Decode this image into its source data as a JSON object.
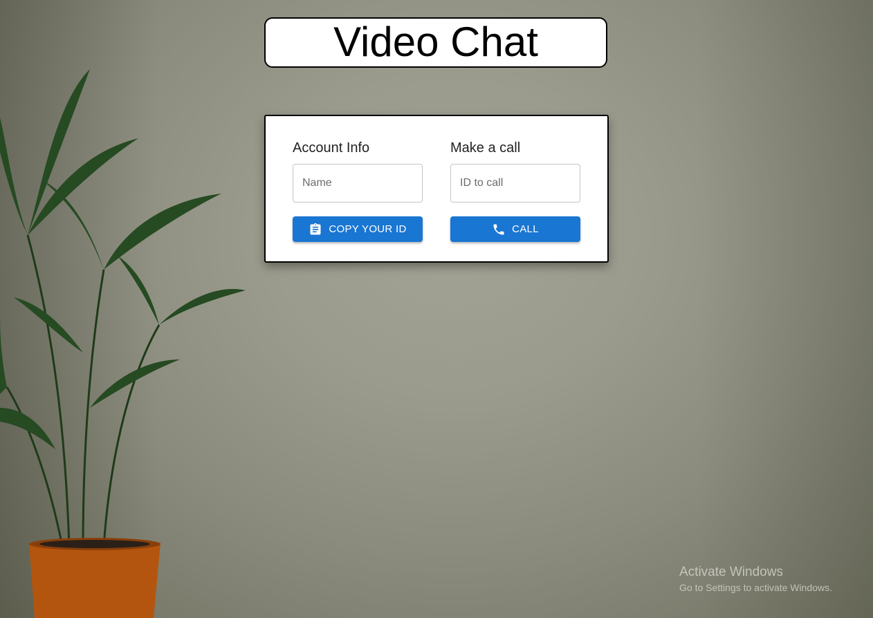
{
  "app": {
    "title": "Video Chat"
  },
  "account": {
    "heading": "Account Info",
    "name_placeholder": "Name",
    "name_value": "",
    "copy_button_label": "COPY YOUR ID",
    "copy_icon": "clipboard-icon"
  },
  "call": {
    "heading": "Make a call",
    "id_placeholder": "ID to call",
    "id_value": "",
    "call_button_label": "CALL",
    "call_icon": "phone-icon"
  },
  "watermark": {
    "title": "Activate Windows",
    "subtitle": "Go to Settings to activate Windows."
  },
  "colors": {
    "accent": "#1976d2",
    "background": "#9b9b8d"
  }
}
